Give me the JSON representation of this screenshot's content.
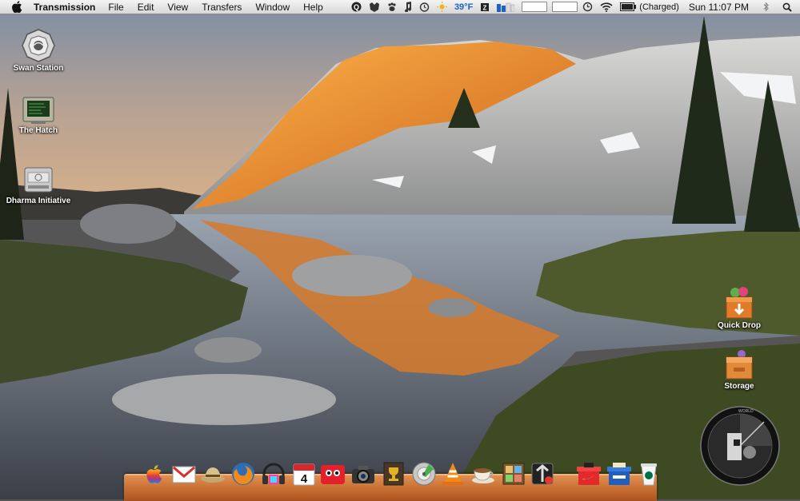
{
  "menubar": {
    "app_name": "Transmission",
    "menus": [
      "File",
      "Edit",
      "View",
      "Transfers",
      "Window",
      "Help"
    ],
    "weather": "39°F",
    "battery_status": "(Charged)",
    "clock": "Sun 11:07 PM"
  },
  "desktop": {
    "icons": [
      {
        "label": "Swan Station"
      },
      {
        "label": "The Hatch"
      },
      {
        "label": "Dharma Initiative"
      },
      {
        "label": "Quick Drop"
      },
      {
        "label": "Storage"
      }
    ]
  },
  "dock": {
    "items": [
      "apple-icon",
      "gmail-icon",
      "safari-hat-icon",
      "firefox-icon",
      "itunes-headphones-icon",
      "calendar-icon",
      "photobooth-icon",
      "camera-icon",
      "trophy-icon",
      "disk-utility-icon",
      "vlc-icon",
      "coffee-cup-icon",
      "dashboard-icon",
      "transmission-icon",
      "nike-shoebox-icon",
      "reebok-shoebox-icon",
      "starbucks-cup-icon"
    ],
    "calendar_day": "4"
  },
  "widget": {
    "label": "WORLD"
  },
  "colors": {
    "menubar": "#e6e6e6",
    "dock_wood": "#c46a2e",
    "weather_blue": "#1d61c9"
  }
}
